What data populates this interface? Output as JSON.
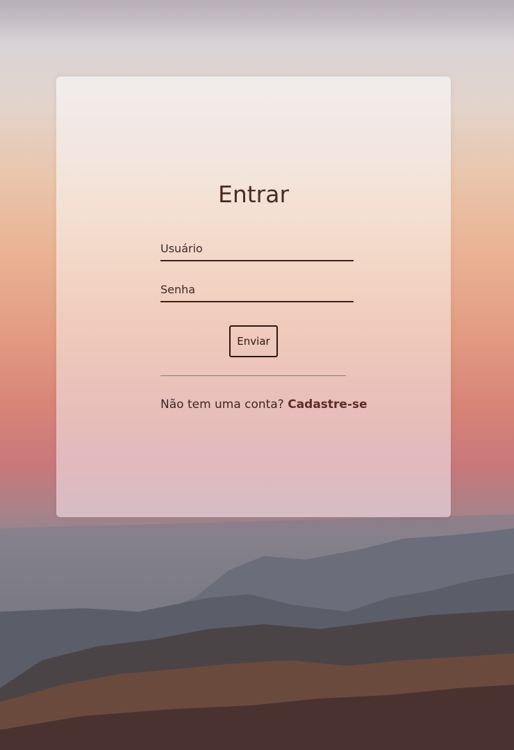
{
  "login": {
    "title": "Entrar",
    "username_placeholder": "Usuário",
    "password_placeholder": "Senha",
    "submit_label": "Enviar",
    "signup_prompt": "Não tem uma conta?",
    "signup_link": "Cadastre-se"
  },
  "colors": {
    "text_dark": "#4a2a25",
    "link": "#5a2e25",
    "field_underline": "#3c1f1c"
  }
}
